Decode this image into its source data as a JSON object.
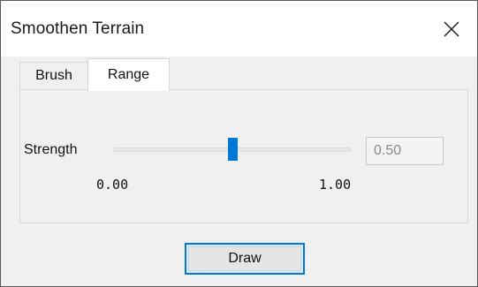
{
  "window": {
    "title": "Smoothen Terrain"
  },
  "tabs": [
    {
      "label": "Brush",
      "active": false
    },
    {
      "label": "Range",
      "active": true
    }
  ],
  "strength": {
    "label": "Strength",
    "value": 0.5,
    "min_label": "0.00",
    "max_label": "1.00",
    "value_text": "0.50",
    "accent_color": "#0078d7"
  },
  "actions": {
    "draw_label": "Draw"
  },
  "icons": {
    "close": "close-icon"
  }
}
